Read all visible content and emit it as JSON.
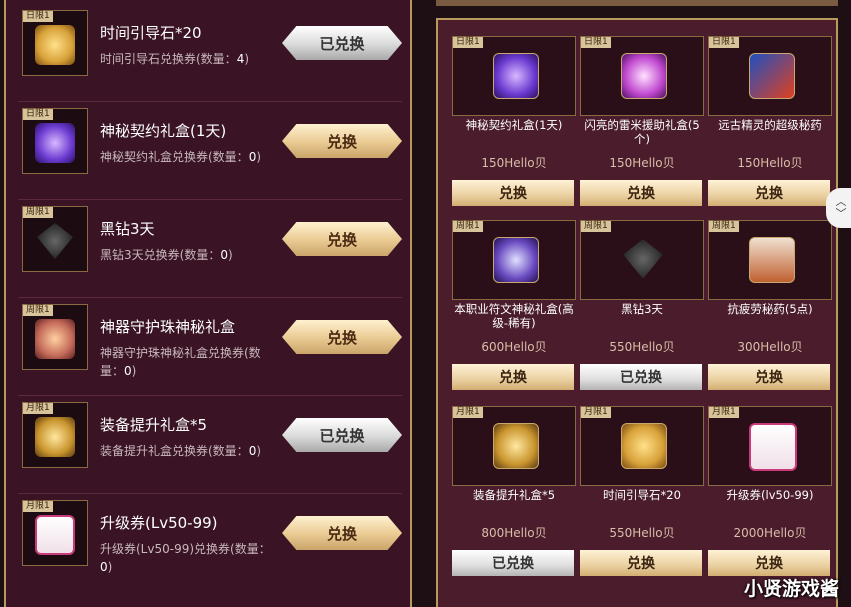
{
  "left": {
    "items": [
      {
        "tag": "日限1",
        "title": "时间引导石*20",
        "desc": "时间引导石兑换券(数量：",
        "qty": "4",
        "desc_end": ")",
        "button": "已兑换",
        "state": "done",
        "icon": "gold-chest-icon",
        "color": "#d8a23a"
      },
      {
        "tag": "日限1",
        "title": "神秘契约礼盒(1天)",
        "desc": "神秘契约礼盒兑换券(数量：",
        "qty": "0",
        "desc_end": ")",
        "button": "兑换",
        "state": "active",
        "icon": "purple-bag-icon",
        "color": "#6b3ad0"
      },
      {
        "tag": "周限1",
        "title": "黑钻3天",
        "desc": "黑钻3天兑换券(数量：",
        "qty": "0",
        "desc_end": ")",
        "button": "兑换",
        "state": "active",
        "icon": "black-diamond-icon",
        "color": "#2b2b2b"
      },
      {
        "tag": "周限1",
        "title": "神器守护珠神秘礼盒",
        "desc": "神器守护珠神秘礼盒兑换券(数量：",
        "qty": "0",
        "desc_end": ")",
        "button": "兑换",
        "state": "active",
        "icon": "guard-orb-box-icon",
        "color": "#c46a5a"
      },
      {
        "tag": "月限1",
        "title": "装备提升礼盒*5",
        "desc": "装备提升礼盒兑换券(数量：",
        "qty": "0",
        "desc_end": ")",
        "button": "已兑换",
        "state": "done",
        "icon": "upgrade-box-icon",
        "color": "#c9952e"
      },
      {
        "tag": "月限1",
        "title": "升级券(Lv50-99)",
        "desc": "升级券(Lv50-99)兑换券(数量：",
        "qty": "0",
        "desc_end": ")",
        "button": "兑换",
        "state": "active",
        "icon": "level-ticket-icon",
        "color": "#f0e0e8"
      }
    ]
  },
  "right": {
    "items": [
      {
        "tag": "日限1",
        "name": "神秘契约礼盒(1天)",
        "price": "150Hello贝",
        "button": "兑换",
        "state": "active",
        "icon": "purple-bag-icon",
        "color": "#6b3ad0"
      },
      {
        "tag": "日限1",
        "name": "闪亮的雷米援助礼盒(5个)",
        "price": "150Hello贝",
        "button": "兑换",
        "state": "active",
        "icon": "remy-gift-icon",
        "color": "#c04ad0"
      },
      {
        "tag": "日限1",
        "name": "远古精灵的超级秘药",
        "price": "150Hello贝",
        "button": "兑换",
        "state": "active",
        "icon": "exp-potion-icon",
        "color": "#2050c0"
      },
      {
        "tag": "周限1",
        "name": "本职业符文神秘礼盒(高级-稀有)",
        "price": "600Hello贝",
        "button": "兑换",
        "state": "active",
        "icon": "rune-box-icon",
        "color": "#6a4ac0"
      },
      {
        "tag": "周限1",
        "name": "黑钻3天",
        "price": "550Hello贝",
        "button": "已兑换",
        "state": "done",
        "icon": "black-diamond-icon",
        "color": "#2b2b2b"
      },
      {
        "tag": "周限1",
        "name": "抗疲劳秘药(5点)",
        "price": "300Hello贝",
        "button": "兑换",
        "state": "active",
        "icon": "fatigue-potion-icon",
        "color": "#c06030"
      },
      {
        "tag": "月限1",
        "name": "装备提升礼盒*5",
        "price": "800Hello贝",
        "button": "已兑换",
        "state": "done",
        "icon": "upgrade-box-icon",
        "color": "#c9952e"
      },
      {
        "tag": "月限1",
        "name": "时间引导石*20",
        "price": "550Hello贝",
        "button": "兑换",
        "state": "active",
        "icon": "gold-chest-icon",
        "color": "#d8a23a"
      },
      {
        "tag": "月限1",
        "name": "升级券(lv50-99)",
        "price": "2000Hello贝",
        "button": "兑换",
        "state": "active",
        "icon": "level-ticket-icon",
        "color": "#f0e0e8"
      }
    ]
  },
  "scroll": {
    "up": "︿",
    "down": "﹀"
  },
  "watermark": "小贤游戏酱"
}
